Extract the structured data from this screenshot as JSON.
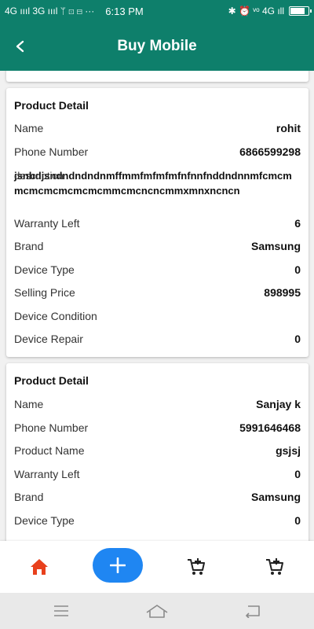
{
  "status_bar": {
    "left": "4G ıııl 3G ıııl  ᛘ  ⊡  ⊟  ···",
    "time": "6:13 PM",
    "right": "✱  ⏰  ᵛᵒ 4G ıll",
    "battery_level": 0.85
  },
  "app_bar": {
    "back_icon": "back-arrow-icon",
    "title": "Buy Mobile"
  },
  "cards": [
    {
      "title": "Product Detail",
      "rows": [
        {
          "label": "Name",
          "value": "rohit"
        },
        {
          "label": "Phone Number",
          "value": "6866599298"
        }
      ],
      "description": {
        "label": "description",
        "value": "jsnbdjsndndndndnmffmmfmfmfmfnfnnfnddndnnmfcmcmmcmcmcmcmcmcmmcmcncncmmxmnxncncn"
      },
      "rows2": [
        {
          "label": "Warranty Left",
          "value": "6"
        },
        {
          "label": "Brand",
          "value": "Samsung"
        },
        {
          "label": "Device Type",
          "value": "0"
        },
        {
          "label": "Selling Price",
          "value": "898995"
        },
        {
          "label": "Device Condition",
          "value": ""
        },
        {
          "label": "Device Repair",
          "value": "0"
        }
      ]
    },
    {
      "title": "Product Detail",
      "rows": [
        {
          "label": "Name",
          "value": "Sanjay k"
        },
        {
          "label": "Phone Number",
          "value": "5991646468"
        },
        {
          "label": "Product Name",
          "value": "gsjsj"
        },
        {
          "label": "Warranty Left",
          "value": "0"
        },
        {
          "label": "Brand",
          "value": "Samsung"
        },
        {
          "label": "Device Type",
          "value": "0"
        }
      ]
    }
  ],
  "bottom_nav": {
    "home_icon": "home-icon",
    "add_icon": "plus-icon",
    "cart_add_icon": "add-to-cart-icon",
    "cart_icon": "cart-icon",
    "home_color": "#e8401c",
    "fab_color": "#1f86f2"
  },
  "system_nav": {
    "menu_icon": "menu-icon",
    "home_icon": "system-home-icon",
    "back_icon": "system-back-icon"
  }
}
